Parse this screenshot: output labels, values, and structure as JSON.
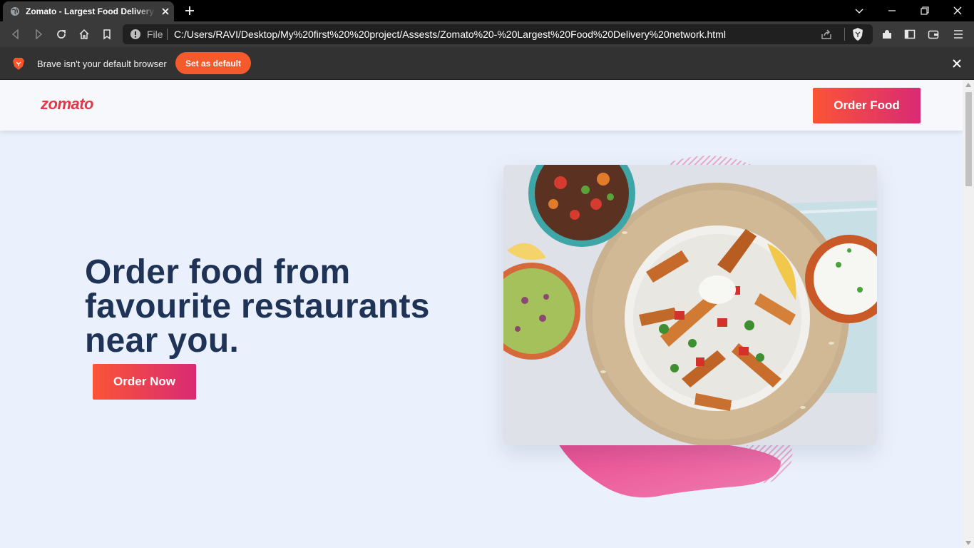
{
  "browser": {
    "tab_title": "Zomato - Largest Food Delivery network",
    "omnibox_scheme": "File",
    "url": "C:/Users/RAVI/Desktop/My%20first%20%20project/Assests/Zomato%20-%20Largest%20Food%20Delivery%20network.html",
    "infobar_message": "Brave isn't your default browser",
    "infobar_button": "Set as default"
  },
  "page": {
    "logo": "zomato",
    "nav_button": "Order Food",
    "hero_title": "Order food from favourite restaurants near you.",
    "hero_button": "Order Now"
  },
  "colors": {
    "brand_red": "#e23744",
    "heading": "#1f3356",
    "button_gradient_start": "#fb5436",
    "button_gradient_end": "#d92a74",
    "page_bg": "#ebf1fc"
  },
  "icons": [
    "globe-icon",
    "close-icon",
    "plus-icon",
    "back-icon",
    "forward-icon",
    "reload-icon",
    "home-icon",
    "bookmark-icon",
    "info-icon",
    "share-icon",
    "brave-shield-icon",
    "extensions-icon",
    "sidebar-icon",
    "wallet-icon",
    "menu-icon",
    "brave-lion-icon"
  ]
}
